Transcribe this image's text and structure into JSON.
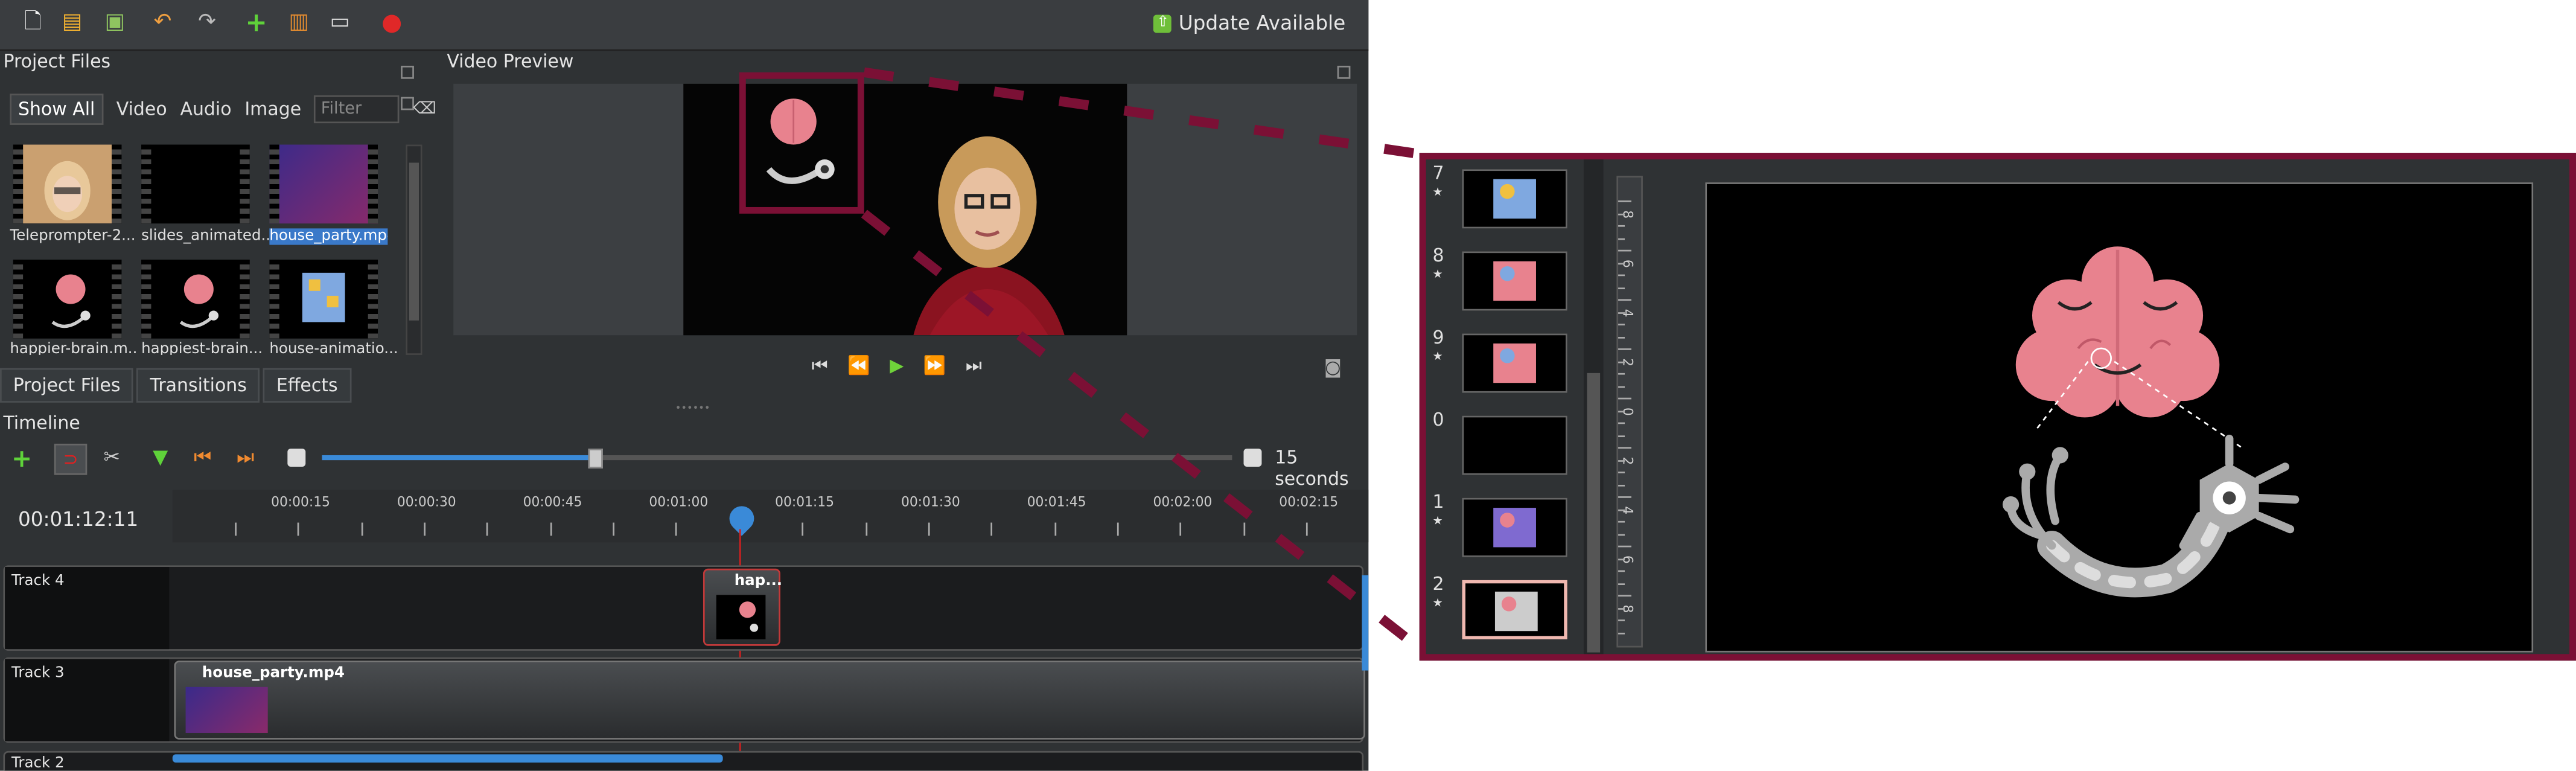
{
  "toolbar": {
    "icons": [
      "new-project-icon",
      "open-project-icon",
      "save-project-icon",
      "undo-icon",
      "redo-icon",
      "add-file-icon",
      "choose-profile-icon",
      "fullscreen-icon",
      "record-icon"
    ],
    "update_label": "Update Available"
  },
  "project_files": {
    "title": "Project Files",
    "filters": [
      "Show All",
      "Video",
      "Audio",
      "Image"
    ],
    "filter_placeholder": "Filter",
    "files": [
      {
        "name": "Teleprompter-2...",
        "selected": false
      },
      {
        "name": "slides_animated...",
        "selected": false
      },
      {
        "name": "house_party.mp4",
        "selected": true
      },
      {
        "name": "happier-brain.m...",
        "selected": false
      },
      {
        "name": "happiest-brain...",
        "selected": false
      },
      {
        "name": "house-animatio...",
        "selected": false
      }
    ]
  },
  "tabs": [
    "Project Files",
    "Transitions",
    "Effects"
  ],
  "video_preview": {
    "title": "Video Preview"
  },
  "timeline": {
    "title": "Timeline",
    "zoom_label": "15 seconds",
    "zoom_level": 0.3,
    "current_time": "00:01:12:11",
    "ruler_labels": [
      "00:00:15",
      "00:00:30",
      "00:00:45",
      "00:01:00",
      "00:01:15",
      "00:01:30",
      "00:01:45",
      "00:02:00",
      "00:02:15"
    ],
    "tracks": [
      {
        "name": "Track 4",
        "clip": "hap..."
      },
      {
        "name": "Track 3",
        "clip": "house_party.mp4"
      },
      {
        "name": "Track 2"
      }
    ]
  },
  "zoom_panel": {
    "rows": [
      {
        "num": "7",
        "star": "★"
      },
      {
        "num": "8",
        "star": "★"
      },
      {
        "num": "9",
        "star": "★"
      },
      {
        "num": "0",
        "star": ""
      },
      {
        "num": "1",
        "star": "★"
      },
      {
        "num": "2",
        "star": "★"
      }
    ],
    "ruler_numbers": [
      "8",
      "6",
      "4",
      "2",
      "0",
      "2",
      "4",
      "6",
      "8"
    ]
  },
  "colors": {
    "accent_highlight": "#7b1035",
    "brain_pink": "#e8828e",
    "selection_blue": "#3a79c9",
    "playhead": "#d02020"
  }
}
